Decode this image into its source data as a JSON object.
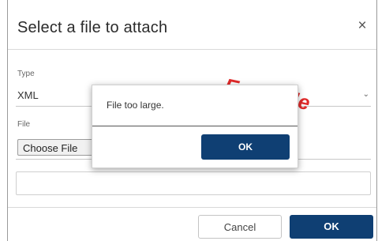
{
  "dialog": {
    "title": "Select a file to attach",
    "close_glyph": "×",
    "type_label": "Type",
    "type_value": "XML",
    "type_chevron": "⌄",
    "file_label": "File",
    "choose_file_label": "Choose File",
    "filename_value": "",
    "cancel_label": "Cancel",
    "ok_label": "OK"
  },
  "alert": {
    "message": "File too large.",
    "ok_label": "OK"
  },
  "watermark": {
    "text": "Example",
    "color": "#e02a2a"
  },
  "colors": {
    "primary_button": "#0f3f73"
  },
  "icons": {
    "close": "close-icon",
    "dropdown": "chevron-down-icon"
  }
}
